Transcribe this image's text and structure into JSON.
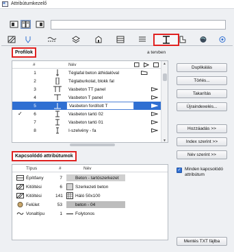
{
  "window": {
    "title": "Attribútumkezelő"
  },
  "search": {
    "value": "",
    "placeholder": ""
  },
  "tabs": [
    {
      "icon": "fill-pattern-icon"
    },
    {
      "icon": "pen-icon"
    },
    {
      "icon": "line-type-icon"
    },
    {
      "icon": "layer-icon"
    },
    {
      "icon": "building-material-icon"
    },
    {
      "icon": "composite-icon"
    },
    {
      "icon": "profile-icon"
    },
    {
      "icon": "zone-category-icon"
    },
    {
      "icon": "surface-icon"
    },
    {
      "icon": "mep-system-icon"
    }
  ],
  "profiles": {
    "label": "Profilok",
    "in_plan_label": "a tervben",
    "columns": {
      "index": "#",
      "name": "Név"
    },
    "rows": [
      {
        "index": "1",
        "name": "Téglafal beton áthidalóval",
        "in_plan": false
      },
      {
        "index": "2",
        "name": "Téglaburkolat, blokk fal",
        "in_plan": false
      },
      {
        "index": "3",
        "name": "Vasbeton TT panel",
        "in_plan": false
      },
      {
        "index": "4",
        "name": "Vasbeton T panel",
        "in_plan": false
      },
      {
        "index": "5",
        "name": "Vasbeton fordított T",
        "in_plan": false,
        "selected": true
      },
      {
        "index": "6",
        "name": "Vasbeton tartó 02",
        "in_plan": true
      },
      {
        "index": "7",
        "name": "Vasbeton tartó 01",
        "in_plan": false
      },
      {
        "index": "8",
        "name": "I-szelvény - fa",
        "in_plan": false
      }
    ]
  },
  "buttons": {
    "duplicate": "Duplikálás",
    "delete": "Törlés...",
    "purge": "Takarítás",
    "reindex": "Újraindexelés...",
    "add": "Hozzáadás >>",
    "by_index": "Index szerint >>",
    "by_name": "Név szerint >>",
    "save_txt": "Mentés TXT fájlba"
  },
  "show_associated": {
    "label": "Minden kapcsolódó attribútum",
    "checked": true
  },
  "associated": {
    "label": "Kapcsolódó attribútumok",
    "columns": {
      "type": "Típus",
      "index": "#",
      "name": "Név"
    },
    "rows": [
      {
        "type": "Építőany",
        "index": "7",
        "name": "Beton - tartószerkezet",
        "icon": "building-material-icon"
      },
      {
        "type": "Kitöltési",
        "index": "6",
        "name": "Szerkezeti beton",
        "icon": "fill-icon"
      },
      {
        "type": "Kitöltési",
        "index": "141",
        "name": "Háló 50x100",
        "icon": "fill-icon"
      },
      {
        "type": "Felület",
        "index": "53",
        "name": "beton - 04",
        "icon": "surface-icon"
      },
      {
        "type": "Vonaltípu",
        "index": "1",
        "name": "Folytonos",
        "icon": "line-type-icon"
      }
    ]
  }
}
